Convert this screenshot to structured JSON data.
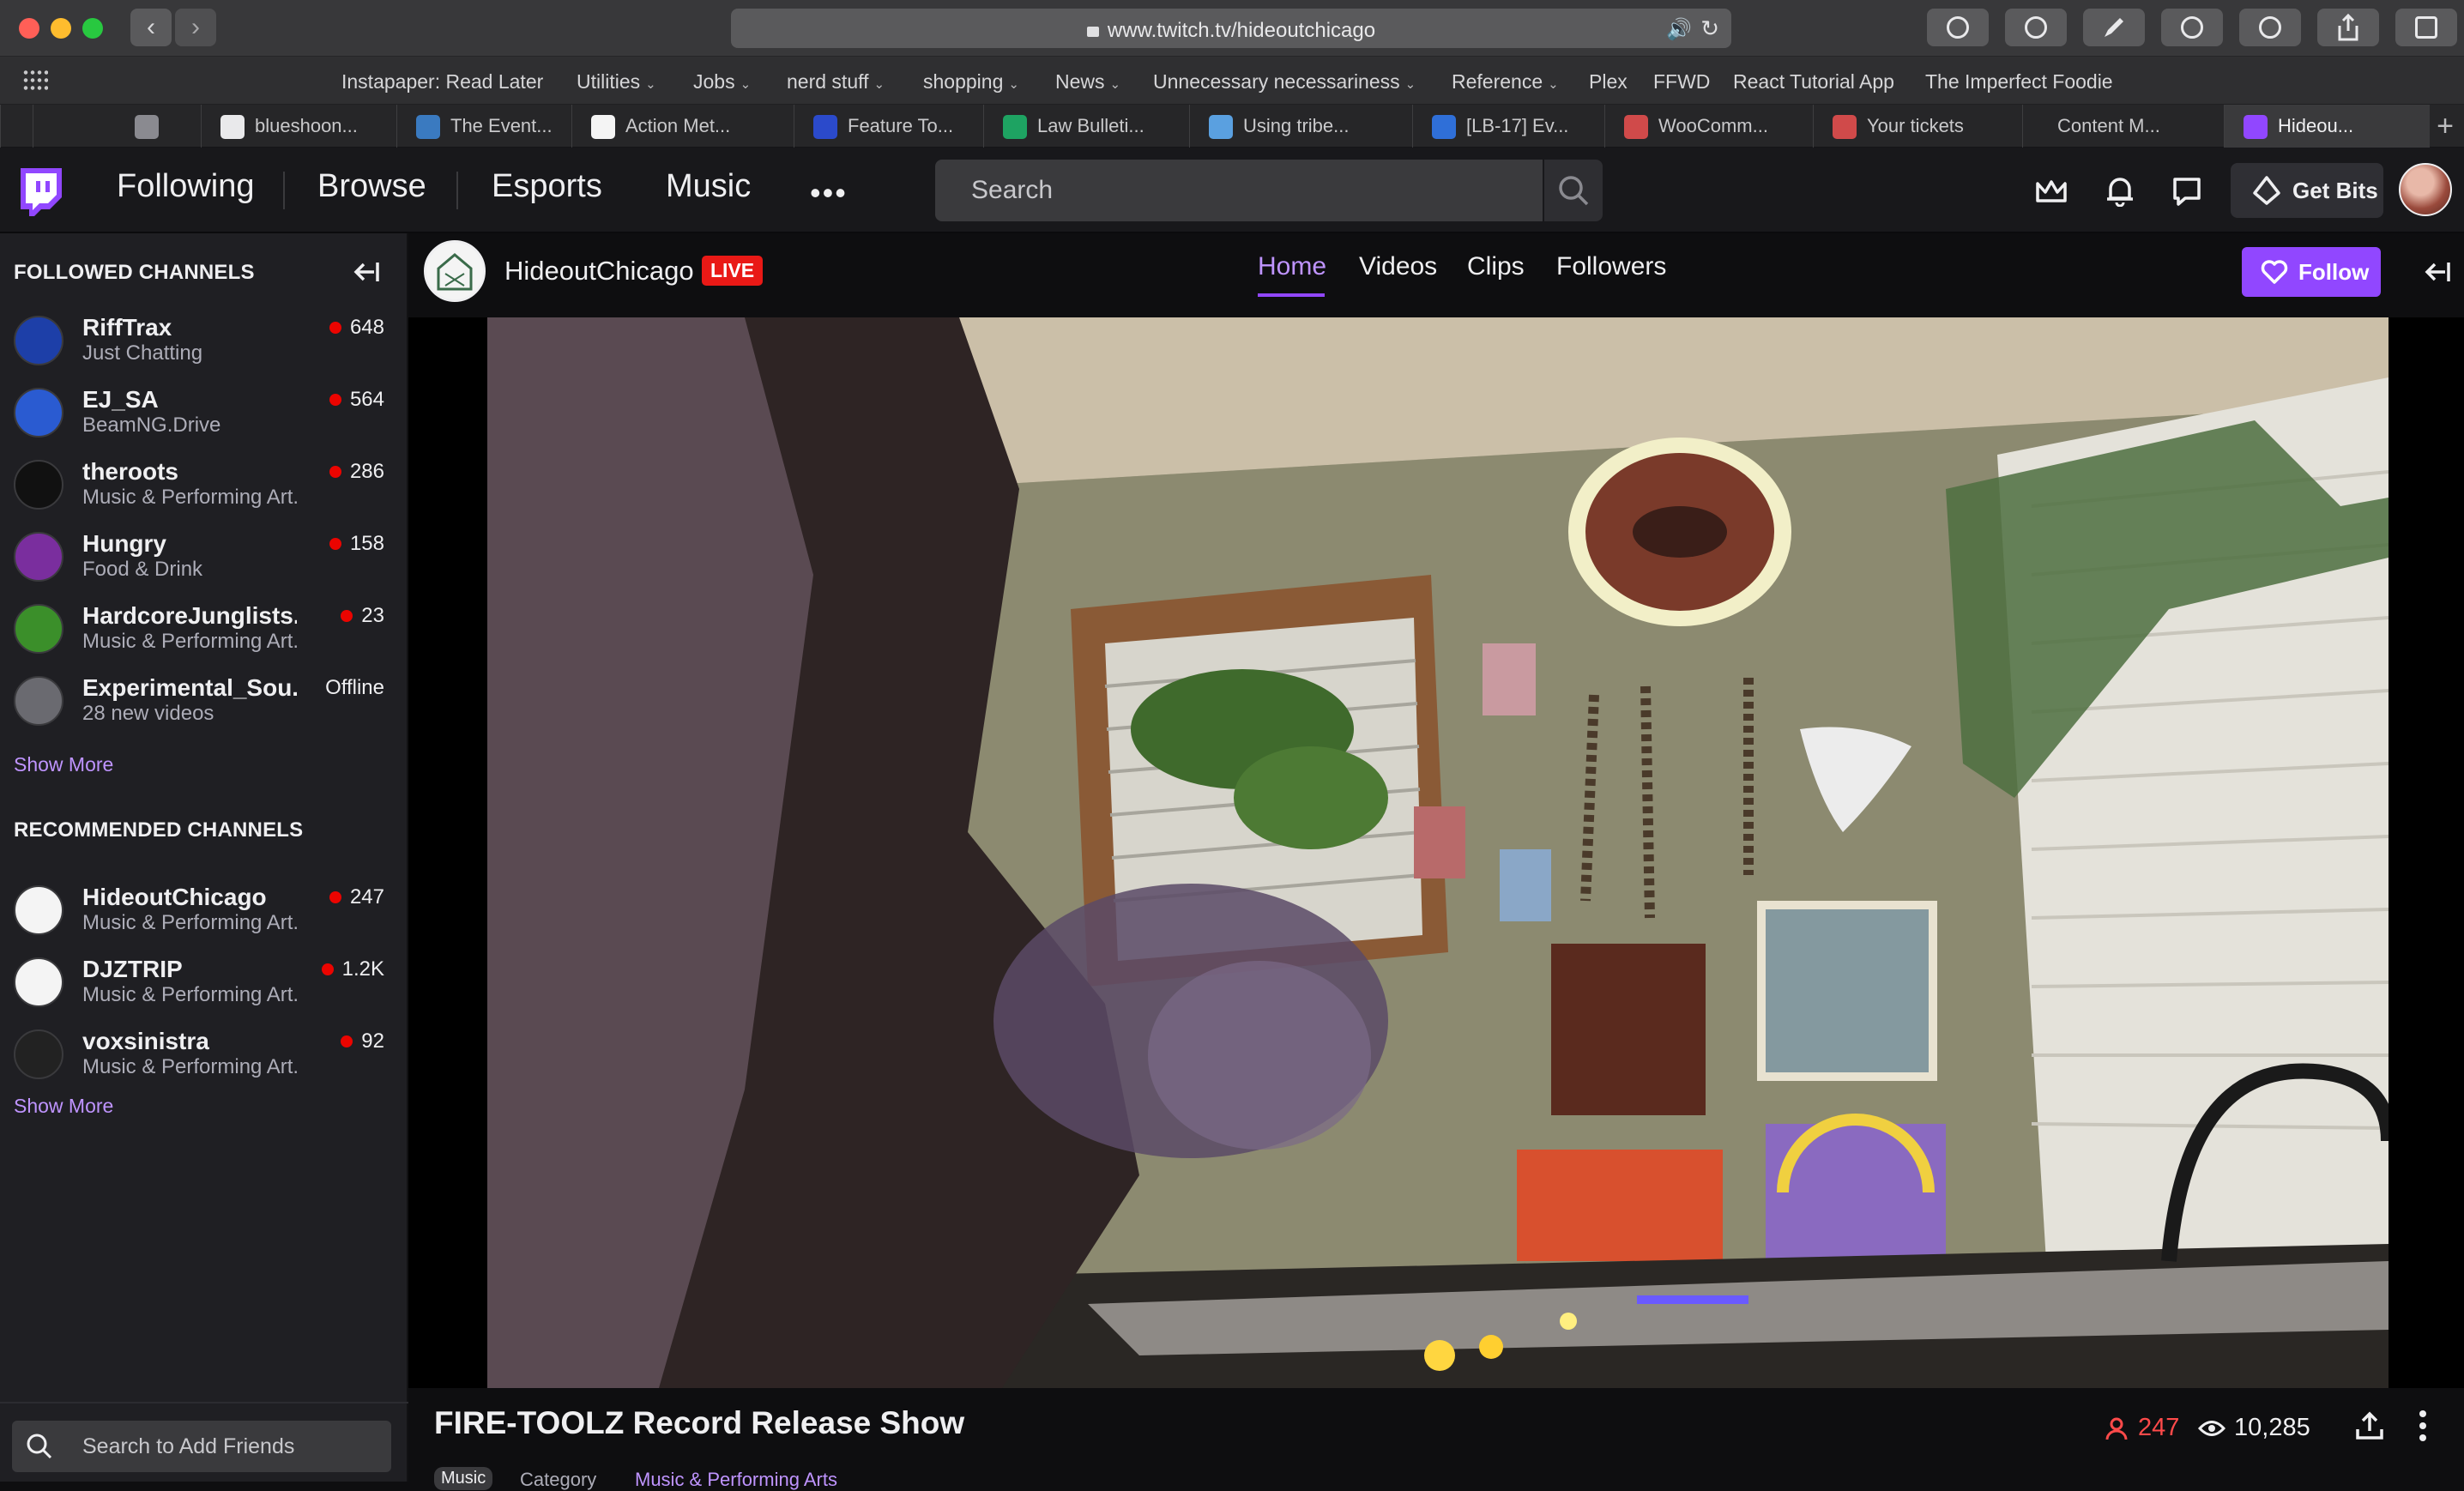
{
  "browser": {
    "url": "www.twitch.tv/hideoutchicago",
    "bookmarks": [
      {
        "label": "Instapaper: Read Later",
        "menu": false
      },
      {
        "label": "Utilities",
        "menu": true
      },
      {
        "label": "Jobs",
        "menu": true
      },
      {
        "label": "nerd stuff",
        "menu": true
      },
      {
        "label": "shopping",
        "menu": true
      },
      {
        "label": "News",
        "menu": true
      },
      {
        "label": "Unnecessary necessariness",
        "menu": true
      },
      {
        "label": "Reference",
        "menu": true
      },
      {
        "label": "Plex",
        "menu": false
      },
      {
        "label": "FFWD",
        "menu": false
      },
      {
        "label": "React Tutorial App",
        "menu": false
      },
      {
        "label": "The Imperfect Foodie",
        "menu": false
      }
    ],
    "tabs": [
      {
        "label": "",
        "icon": "blank-icon"
      },
      {
        "label": "",
        "icon": "b-icon"
      },
      {
        "label": "blueshoon...",
        "icon": "github-icon"
      },
      {
        "label": "The Event...",
        "icon": "wordpress-icon"
      },
      {
        "label": "Action Met...",
        "icon": "a-icon"
      },
      {
        "label": "Feature To...",
        "icon": "f-icon"
      },
      {
        "label": "Law Bulleti...",
        "icon": "plus-icon"
      },
      {
        "label": "Using tribe...",
        "icon": "calendar-icon"
      },
      {
        "label": "[LB-17] Ev...",
        "icon": "jira-icon"
      },
      {
        "label": "WooComm...",
        "icon": "tickets-icon"
      },
      {
        "label": "Your tickets",
        "icon": "tickets-icon"
      },
      {
        "label": "Content M...",
        "icon": "blank-icon"
      },
      {
        "label": "Hideou...",
        "icon": "twitch-icon"
      }
    ]
  },
  "twitch": {
    "nav": {
      "following": "Following",
      "browse": "Browse",
      "esports": "Esports",
      "music": "Music",
      "more": "•••",
      "search_placeholder": "Search",
      "get_bits": "Get Bits"
    },
    "sidebar": {
      "followed_heading": "FOLLOWED CHANNELS",
      "followed": [
        {
          "name": "RiffTrax",
          "category": "Just Chatting",
          "count": "648",
          "live": true,
          "color": "#1d3fa8"
        },
        {
          "name": "EJ_SA",
          "category": "BeamNG.Drive",
          "count": "564",
          "live": true,
          "color": "#2a5bd1"
        },
        {
          "name": "theroots",
          "category": "Music & Performing Art.",
          "count": "286",
          "live": true,
          "color": "#111111"
        },
        {
          "name": "Hungry",
          "category": "Food & Drink",
          "count": "158",
          "live": true,
          "color": "#7a2e9e"
        },
        {
          "name": "HardcoreJunglists...",
          "category": "Music & Performing Art.",
          "count": "23",
          "live": true,
          "color": "#3b8f2a"
        },
        {
          "name": "Experimental_Sou...",
          "category": "28 new videos",
          "count": "Offline",
          "live": false,
          "color": "#6a6a70"
        }
      ],
      "show_more_1": "Show More",
      "recommended_heading": "RECOMMENDED CHANNELS",
      "recommended": [
        {
          "name": "HideoutChicago",
          "category": "Music & Performing Art.",
          "count": "247",
          "live": true,
          "color": "#f4f4f4"
        },
        {
          "name": "DJZTRIP",
          "category": "Music & Performing Art.",
          "count": "1.2K",
          "live": true,
          "color": "#f4f4f4"
        },
        {
          "name": "voxsinistra",
          "category": "Music & Performing Art.",
          "count": "92",
          "live": true,
          "color": "#222222"
        }
      ],
      "show_more_2": "Show More",
      "friends_placeholder": "Search to Add Friends"
    },
    "channel": {
      "name": "HideoutChicago",
      "live_badge": "LIVE",
      "tabs": [
        "Home",
        "Videos",
        "Clips",
        "Followers"
      ],
      "active_tab": "Home",
      "follow": "Follow"
    },
    "stream": {
      "title": "FIRE-TOOLZ Record Release Show",
      "viewers": "247",
      "views": "10,285",
      "category_tag": "Music",
      "category_label": "Category",
      "category_link": "Music & Performing Arts"
    }
  },
  "colors": {
    "accent": "#9147ff",
    "accent_text": "#bf94ff",
    "live_red": "#e91916"
  }
}
